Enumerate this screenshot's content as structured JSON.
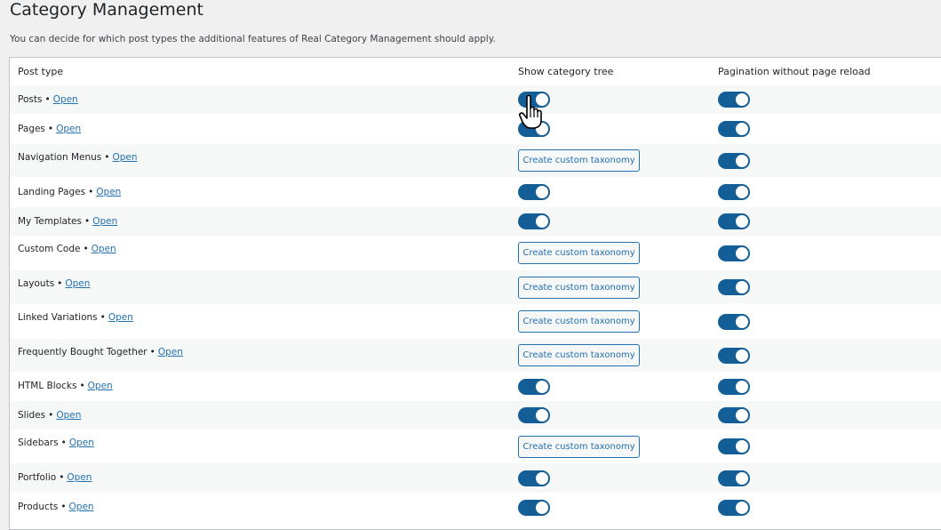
{
  "page": {
    "title": "Category Management",
    "description": "You can decide for which post types the additional features of Real Category Management should apply."
  },
  "table": {
    "headers": {
      "post_type": "Post type",
      "show_tree": "Show category tree",
      "pagination": "Pagination without page reload"
    },
    "separator": "•",
    "open_label": "Open",
    "create_taxonomy_label": "Create custom taxonomy",
    "rows": [
      {
        "name": "Posts",
        "tree": "toggle-on",
        "pagination": "toggle-on"
      },
      {
        "name": "Pages",
        "tree": "toggle-on",
        "pagination": "toggle-on"
      },
      {
        "name": "Navigation Menus",
        "tree": "create-taxonomy",
        "pagination": "toggle-on"
      },
      {
        "name": "Landing Pages",
        "tree": "toggle-on",
        "pagination": "toggle-on"
      },
      {
        "name": "My Templates",
        "tree": "toggle-on",
        "pagination": "toggle-on"
      },
      {
        "name": "Custom Code",
        "tree": "create-taxonomy",
        "pagination": "toggle-on"
      },
      {
        "name": "Layouts",
        "tree": "create-taxonomy",
        "pagination": "toggle-on"
      },
      {
        "name": "Linked Variations",
        "tree": "create-taxonomy",
        "pagination": "toggle-on"
      },
      {
        "name": "Frequently Bought Together",
        "tree": "create-taxonomy",
        "pagination": "toggle-on"
      },
      {
        "name": "HTML Blocks",
        "tree": "toggle-on",
        "pagination": "toggle-on"
      },
      {
        "name": "Slides",
        "tree": "toggle-on",
        "pagination": "toggle-on"
      },
      {
        "name": "Sidebars",
        "tree": "create-taxonomy",
        "pagination": "toggle-on"
      },
      {
        "name": "Portfolio",
        "tree": "toggle-on",
        "pagination": "toggle-on"
      },
      {
        "name": "Products",
        "tree": "toggle-on",
        "pagination": "toggle-on"
      }
    ]
  },
  "colors": {
    "toggle_on": "#135e96",
    "link": "#2271b1",
    "page_bg": "#f0f0f1"
  },
  "cursor": {
    "icon": "hand-pointer-icon"
  }
}
